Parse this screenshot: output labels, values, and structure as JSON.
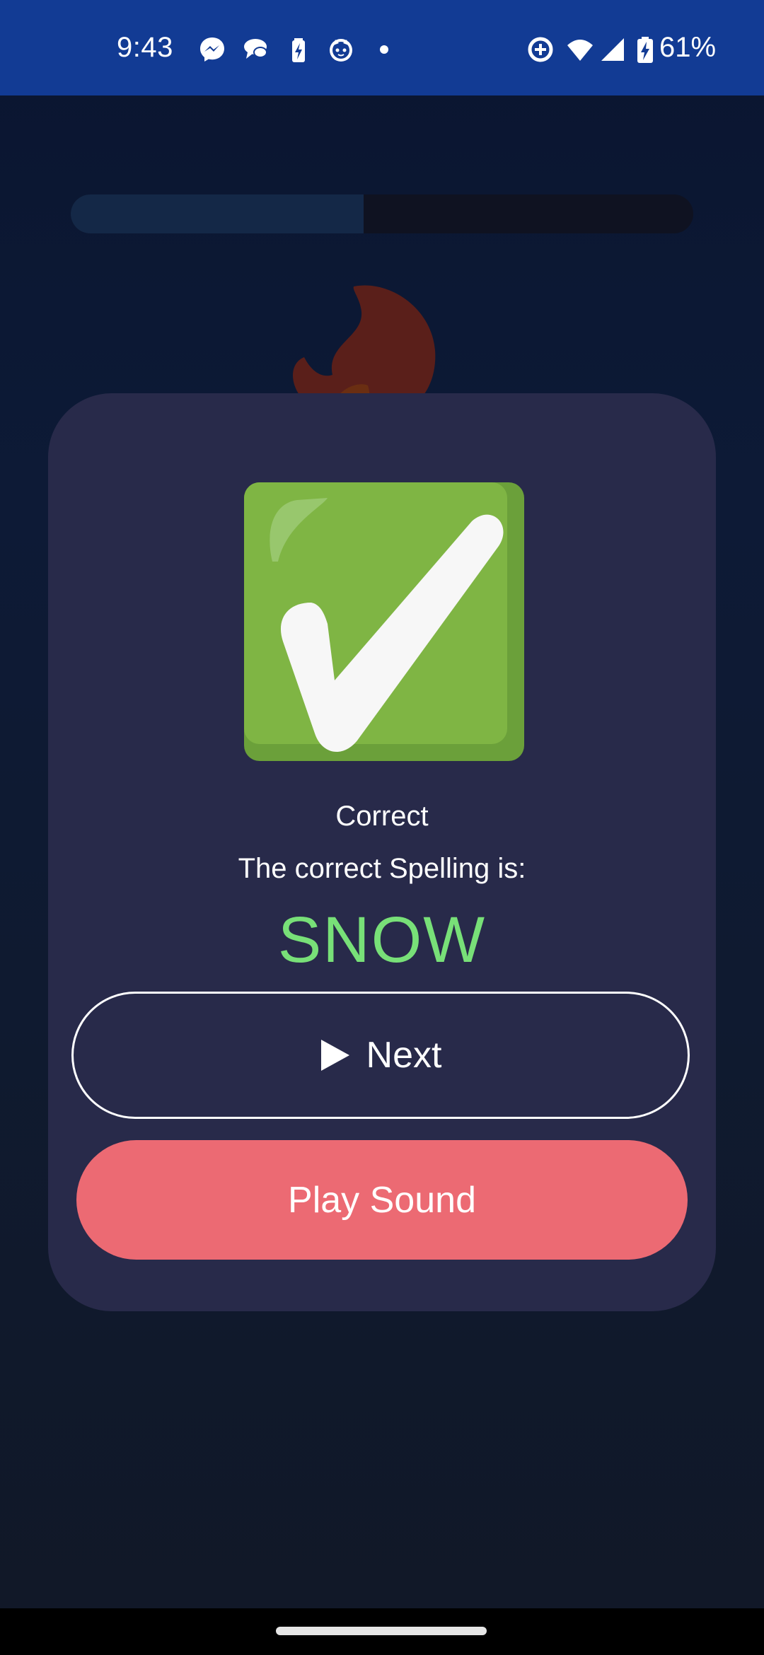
{
  "status_bar": {
    "time": "9:43",
    "battery_percent": "61%",
    "notification_icons": [
      "messenger-icon",
      "chat-bubbles-icon",
      "battery-saver-icon",
      "cat-face-icon",
      "dot-icon"
    ],
    "system_icons": [
      "data-saver-icon",
      "wifi-icon",
      "cell-signal-icon",
      "battery-charging-icon"
    ],
    "background_color": "#123b94"
  },
  "quiz": {
    "progress": 0.47,
    "result_icon": "check-mark-button-icon",
    "result_title": "Correct",
    "result_subtitle": "The correct Spelling is:",
    "answer_word": "SNOW",
    "answer_color": "#78e078"
  },
  "actions": {
    "next_label": "Next",
    "play_sound_label": "Play Sound",
    "play_sound_color": "#ec6a73"
  },
  "colors": {
    "card": "#282a4a",
    "check_green": "#7fb544"
  }
}
